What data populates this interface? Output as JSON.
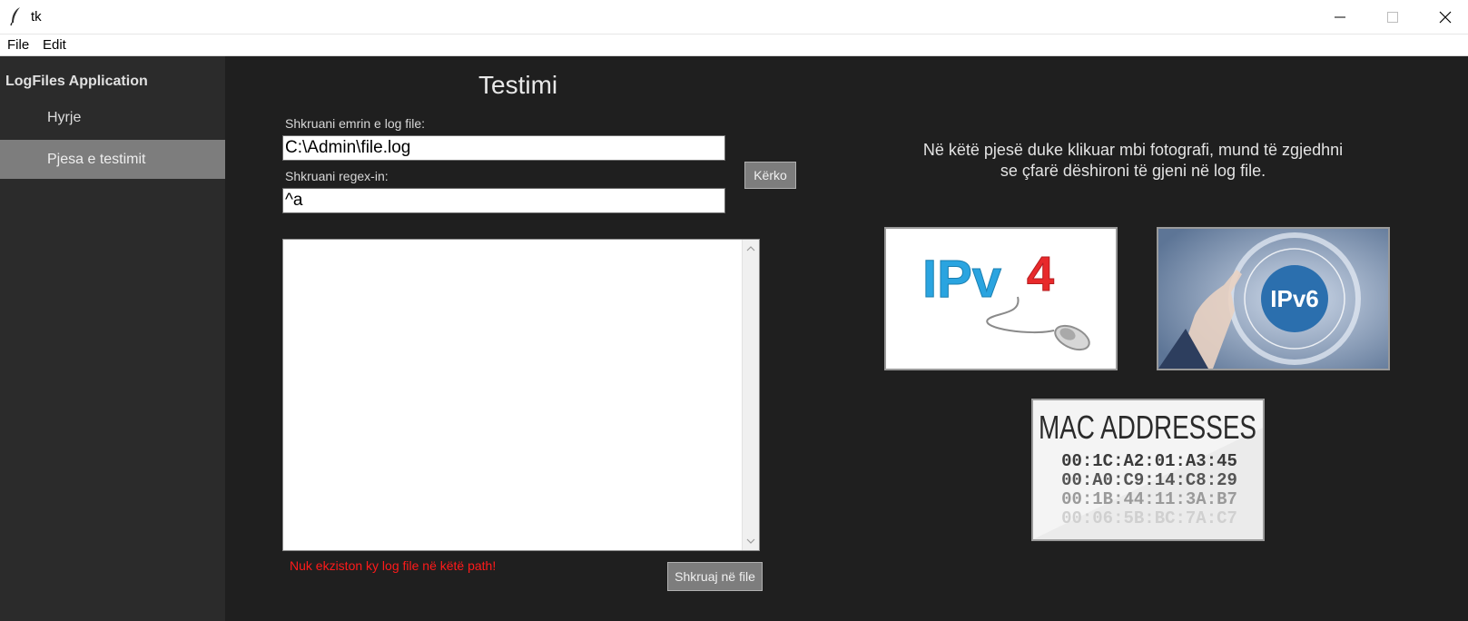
{
  "window": {
    "title": "tk",
    "icon": "feather-icon",
    "controls": [
      "minimize-icon",
      "maximize-icon",
      "close-icon"
    ]
  },
  "menu": {
    "items": [
      "File",
      "Edit"
    ]
  },
  "sidebar": {
    "app_title": "LogFiles Application",
    "items": [
      {
        "label": "Hyrje",
        "active": false
      },
      {
        "label": "Pjesa e testimit",
        "active": true
      }
    ]
  },
  "main": {
    "title": "Testimi",
    "logfile_label": "Shkruani emrin e log file:",
    "logfile_value": "C:\\Admin\\file.log",
    "regex_label": "Shkruani regex-in:",
    "regex_value": "^a",
    "search_button": "Kërko",
    "output_text": "",
    "error_message": "Nuk ekziston ky log file në këtë path!",
    "save_button": "Shkruaj në file"
  },
  "info": {
    "text": "Në këtë pjesë duke klikuar mbi fotografi, mund të zgjedhni se çfarë dëshironi të gjeni në log file."
  },
  "images": {
    "ipv4": {
      "text_ip": "IPv",
      "text_num": "4"
    },
    "ipv6": {
      "text": "IPv6"
    },
    "mac": {
      "title": "MAC ADDRESSES",
      "lines": [
        "00:1C:A2:01:A3:45",
        "00:A0:C9:14:C8:29",
        "00:1B:44:11:3A:B7",
        "00:06:5B:BC:7A:C7"
      ]
    }
  },
  "colors": {
    "background": "#1f1f1f",
    "sidebar": "#2b2b2b",
    "active_item": "#7d7d7d",
    "error": "#ff1a1a",
    "ipv4_blue": "#2aa4e0",
    "ipv4_red": "#e8292b"
  }
}
